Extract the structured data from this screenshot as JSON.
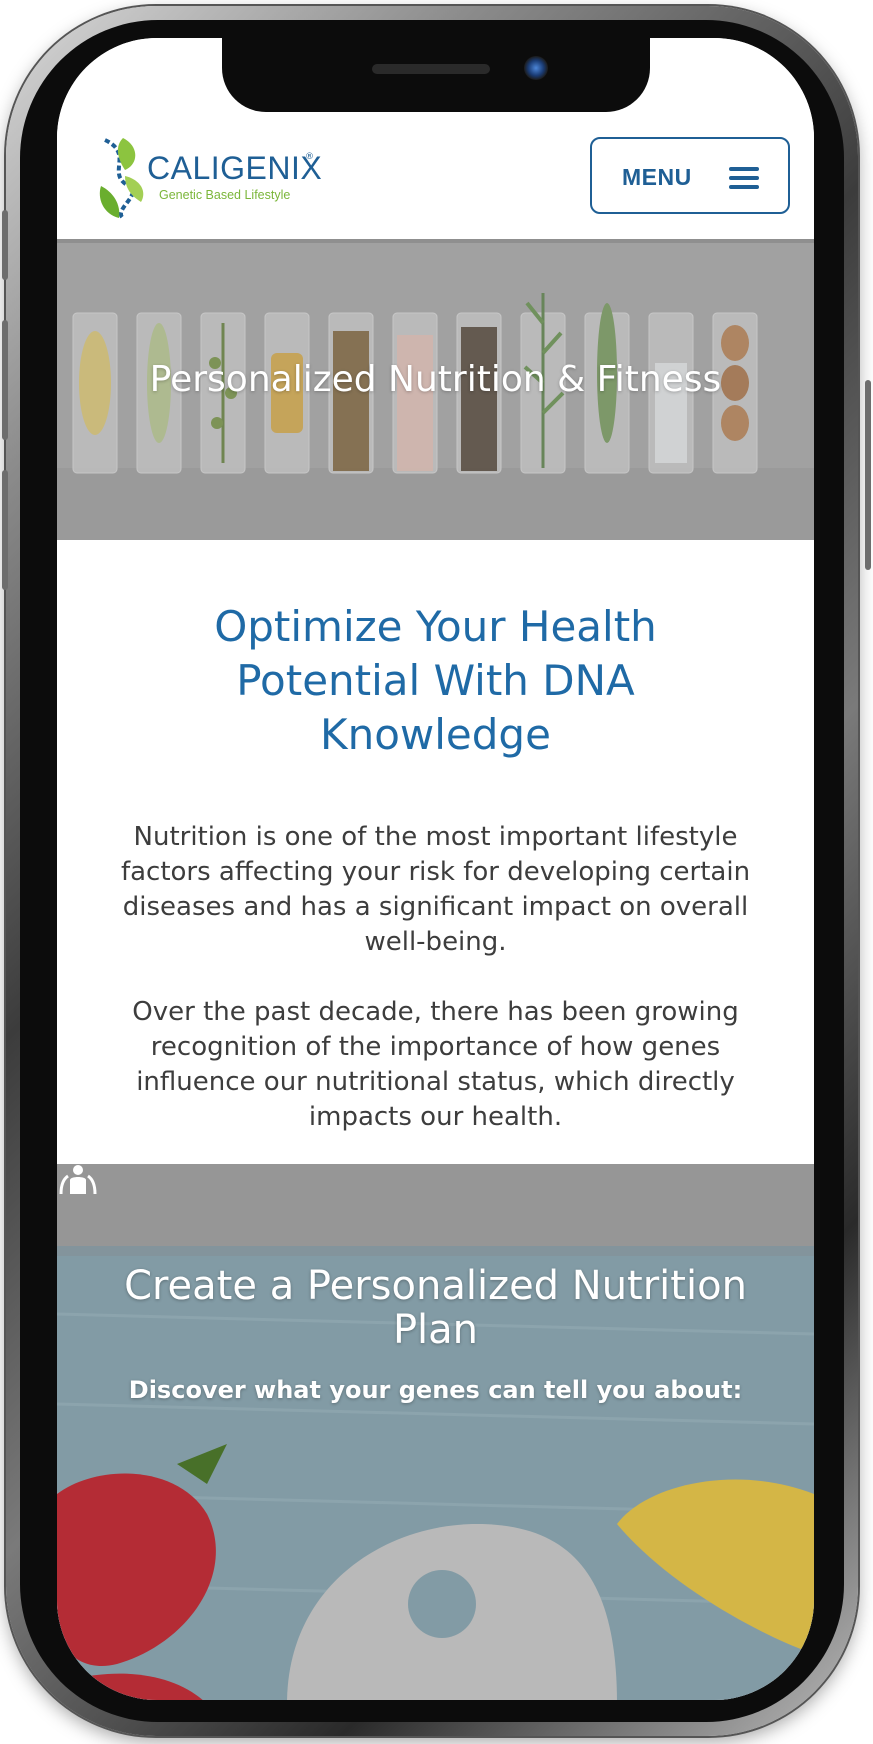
{
  "header": {
    "brand_name": "CALIGENIX",
    "brand_registered": "®",
    "brand_tagline": "Genetic Based Lifestyle",
    "menu_label": "MENU",
    "menu_icon": "hamburger-icon"
  },
  "hero": {
    "title": "Personalized Nutrition & Fitness"
  },
  "intro": {
    "heading": "Optimize Your Health Potential With DNA Knowledge",
    "paragraph_1": "Nutrition is one of the most important lifestyle factors affecting your risk for developing certain diseases and has a significant impact on overall well-being.",
    "paragraph_2": "Over the past decade, there has been growing recognition of the importance of how genes influence our nutritional status, which directly impacts our health."
  },
  "plan": {
    "title": "Create a Personalized Nutrition Plan",
    "subtitle": "Discover what your genes can tell you about:",
    "icon": "person-icon"
  },
  "colors": {
    "brand_blue": "#1f5f95",
    "heading_blue": "#1f6aa6",
    "brand_green": "#7bb63a",
    "body_text": "#3d3d3d"
  }
}
